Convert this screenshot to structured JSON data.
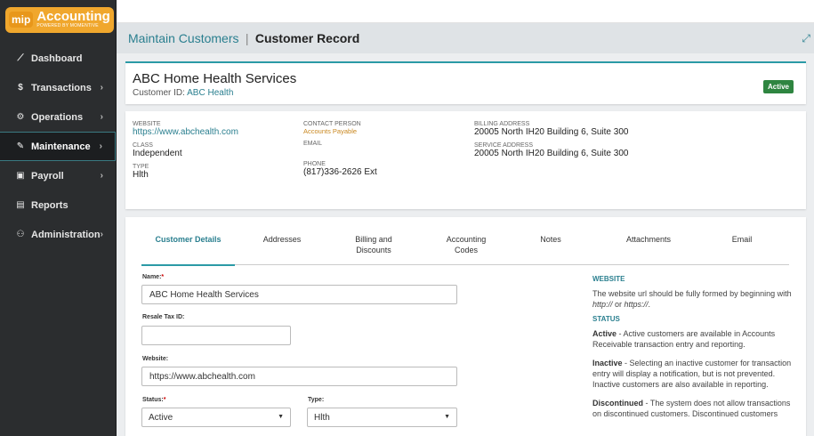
{
  "logo": {
    "badge": "mip",
    "title": "Accounting",
    "subtitle": "POWERED BY MOMENTIVE"
  },
  "sidebar": {
    "items": [
      {
        "label": "Dashboard",
        "icon": "chart-line-icon",
        "glyph": "⟋",
        "chevron": ""
      },
      {
        "label": "Transactions",
        "icon": "dollar-icon",
        "glyph": "$",
        "chevron": "›"
      },
      {
        "label": "Operations",
        "icon": "gears-icon",
        "glyph": "⚙",
        "chevron": "›"
      },
      {
        "label": "Maintenance",
        "icon": "wrench-icon",
        "glyph": "✎",
        "chevron": "›"
      },
      {
        "label": "Payroll",
        "icon": "money-icon",
        "glyph": "▣",
        "chevron": "›"
      },
      {
        "label": "Reports",
        "icon": "file-icon",
        "glyph": "▤",
        "chevron": ""
      },
      {
        "label": "Administration",
        "icon": "users-icon",
        "glyph": "⚇",
        "chevron": "›"
      }
    ]
  },
  "header": {
    "breadcrumb": "Maintain Customers",
    "separator": "|",
    "current": "Customer Record",
    "expand_glyph": "⤢"
  },
  "customer": {
    "name": "ABC Home Health Services",
    "id_label": "Customer ID:",
    "id": "ABC Health",
    "status_badge": "Active"
  },
  "info": {
    "website_label": "WEBSITE",
    "website": "https://www.abchealth.com",
    "class_label": "CLASS",
    "class": "Independent",
    "type_label": "TYPE",
    "type": "Hlth",
    "contact_label": "CONTACT PERSON",
    "contact": "Accounts Payable",
    "email_label": "EMAIL",
    "email": "",
    "phone_label": "PHONE",
    "phone": "(817)336-2626 Ext",
    "billing_label": "BILLING ADDRESS",
    "billing": "20005 North IH20 Building 6, Suite 300",
    "service_label": "SERVICE ADDRESS",
    "service": "20005 North IH20 Building 6, Suite 300"
  },
  "tabs": [
    {
      "label": "Customer Details"
    },
    {
      "label": "Addresses"
    },
    {
      "label": "Billing and Discounts"
    },
    {
      "label": "Accounting Codes"
    },
    {
      "label": "Notes"
    },
    {
      "label": "Attachments"
    },
    {
      "label": "Email"
    }
  ],
  "form": {
    "name_label": "Name:",
    "name_value": "ABC Home Health Services",
    "resale_label": "Resale Tax ID:",
    "resale_value": "",
    "website_label": "Website:",
    "website_value": "https://www.abchealth.com",
    "status_label": "Status:",
    "status_value": "Active",
    "type_label": "Type:",
    "type_value": "Hlth",
    "required_mark": "*"
  },
  "help": {
    "website_title": "WEBSITE",
    "website_text_1": "The website url should be fully formed by beginning with ",
    "website_ex1": "http://",
    "website_text_2": " or ",
    "website_ex2": "https://",
    "website_text_3": ".",
    "status_title": "STATUS",
    "active_term": "Active",
    "active_text": " - Active customers are available in Accounts Receivable transaction entry and reporting.",
    "inactive_term": "Inactive",
    "inactive_text": " - Selecting an inactive customer for transaction entry will display a notification, but is not prevented. Inactive customers are also available in reporting.",
    "discontinued_term": "Discontinued",
    "discontinued_text": " - The system does not allow transactions on discontinued customers. Discontinued customers"
  },
  "colors": {
    "accent": "#2b9aa6",
    "link": "#2a7f8f",
    "badge": "#2e8540",
    "logo": "#f0a72d",
    "sidebar": "#2b2d2f"
  }
}
